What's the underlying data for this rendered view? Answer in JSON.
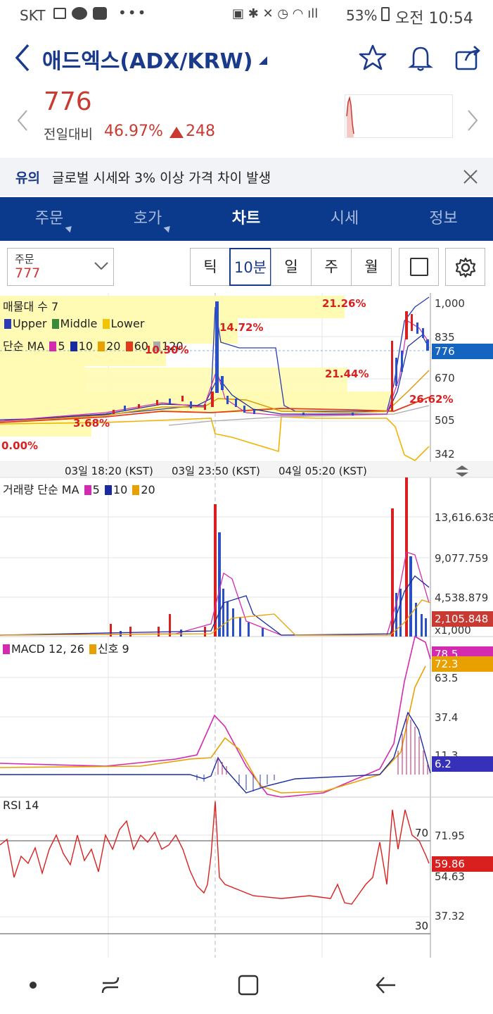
{
  "status_bar": {
    "carrier": "SKT",
    "battery": "53%",
    "time": "오전 10:54"
  },
  "header": {
    "title": "애드엑스(ADX/KRW)"
  },
  "price": {
    "current": "776",
    "change_label": "전일대비",
    "change_pct": "46.97%",
    "change_abs": "248"
  },
  "notice": {
    "tag": "유의",
    "message": "글로벌 시세와 3% 이상 가격 차이 발생"
  },
  "tabs": [
    {
      "label": "주문"
    },
    {
      "label": "호가"
    },
    {
      "label": "차트"
    },
    {
      "label": "시세"
    },
    {
      "label": "정보"
    }
  ],
  "toolbar": {
    "order_label": "주문",
    "order_price": "777",
    "periods": [
      "틱",
      "10분",
      "일",
      "주",
      "월"
    ],
    "selected_period": "10분"
  },
  "chart": {
    "main_title": "매물대 수 7",
    "bands": [
      "Upper",
      "Middle",
      "Lower"
    ],
    "ma_label": "단순 MA",
    "ma_periods": [
      "5",
      "10",
      "20",
      "60",
      "120"
    ],
    "y_ticks": [
      "1,000",
      "835",
      "670",
      "505",
      "342"
    ],
    "current_tag": "776",
    "pct_labels": [
      "21.26%",
      "14.72%",
      "10.30%",
      "21.44%",
      "26.62%",
      "3.68%",
      "0.00%"
    ],
    "time_labels": [
      "03일 18:20 (KST)",
      "03일 23:50 (KST)",
      "04일 05:20 (KST)"
    ],
    "volume_title": "거래량 단순 MA",
    "volume_periods": [
      "5",
      "10",
      "20"
    ],
    "volume_ticks": [
      "13,616.638",
      "9,077.759",
      "4,538.879"
    ],
    "volume_tag": "2,105.848",
    "volume_unit": "x1,000",
    "macd_title": "MACD 12, 26",
    "macd_signal": "신호 9",
    "macd_ticks": [
      "63.5",
      "37.4",
      "11.3"
    ],
    "macd_tags": [
      "78.5",
      "72.3",
      "6.2"
    ],
    "rsi_title": "RSI 14",
    "rsi_ticks": [
      "71.95",
      "54.63",
      "37.32"
    ],
    "rsi_levels": [
      "70",
      "30"
    ],
    "rsi_tag": "59.86"
  },
  "colors": {
    "up": "#d9201f",
    "brand": "#0b3a8c",
    "highlight": "#fffbb4"
  }
}
